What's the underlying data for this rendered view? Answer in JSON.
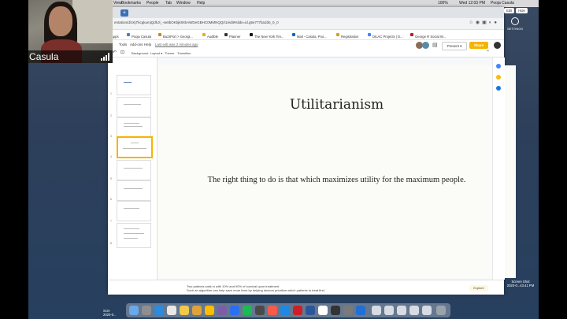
{
  "menubar": {
    "items": [
      "View",
      "Bookmarks",
      "People",
      "Tab",
      "Window",
      "Help"
    ],
    "status": "100%",
    "datetime": "Wed 12:03 PM",
    "user": "Pooja Casula"
  },
  "browser": {
    "url": "entation/d/1KjTkcgkumjQdhJl_-se8bOKbjk8XkAWDeGBHC0MMNQQI/1/edit#slide=id.g5e777ba1bb_0_0",
    "bookmarks": [
      "Apps",
      "Pooja Casula",
      "BuzzPort > Georgi...",
      "Audible",
      "Planner",
      "The New York Tim...",
      "Mail - Casula, Poo...",
      "Registration",
      "DILAC Projects | D...",
      "George R Social W..."
    ]
  },
  "docs": {
    "menu": [
      "Tools",
      "Add-ons",
      "Help"
    ],
    "last_edit": "Last edit was 2 minutes ago",
    "toolbar": [
      "Background",
      "Layout ▾",
      "Theme",
      "Transition"
    ],
    "present_label": "Present",
    "share_label": "Share"
  },
  "slide": {
    "title": "Utilitarianism",
    "body": "The right thing to do is that which maximizes utility for the maximum people."
  },
  "notes": {
    "line1": "Two patients walk in with 10% and 90% of survival upon treatment.",
    "line2": "Such an algorithm can help save more lives by helping doctors prioritize which patients to treat first."
  },
  "explore_label": "Explore",
  "webcam": {
    "name": "Pooja Casula"
  },
  "desktop": {
    "edit_buttons": [
      "Edit",
      "Hide"
    ],
    "settings_label": "SETTINGS",
    "screenshot_label": "Screen Shot",
    "screenshot_date": "2020-0...43.41 PM",
    "left_label": "Scre",
    "left_date": "2020-0..."
  },
  "filmstrip": {
    "slide_numbers": [
      "1",
      "2",
      "3",
      "4",
      "5",
      "6",
      "7",
      "8"
    ],
    "selected": 4
  },
  "colors": {
    "share": "#f4b400",
    "slide_bg": "#fbfbf7",
    "selected_thumb": "#f4b400"
  }
}
